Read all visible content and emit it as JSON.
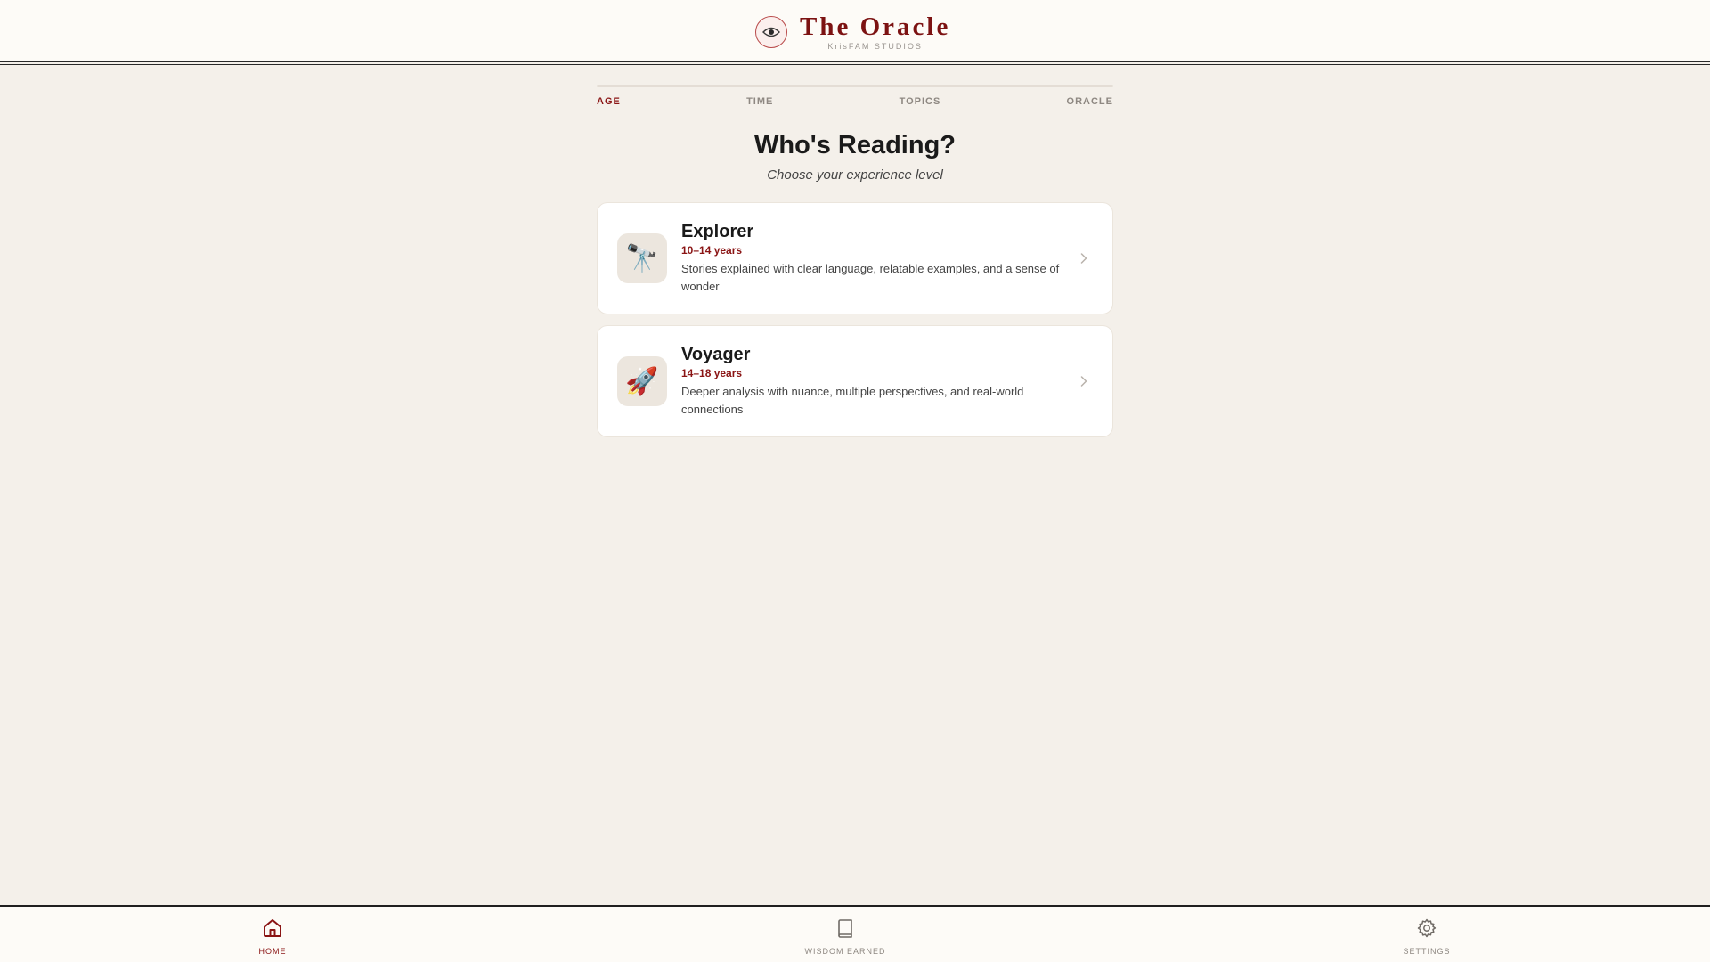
{
  "brand": {
    "title": "The Oracle",
    "subtitle": "KrisFAM STUDIOS",
    "logo_icon": "eye-icon",
    "accent_color": "#7c1212"
  },
  "steps": {
    "items": [
      {
        "label": "AGE",
        "active": true
      },
      {
        "label": "TIME",
        "active": false
      },
      {
        "label": "TOPICS",
        "active": false
      },
      {
        "label": "ORACLE",
        "active": false
      }
    ]
  },
  "heading": {
    "title": "Who's Reading?",
    "subtitle": "Choose your experience level"
  },
  "options": [
    {
      "title": "Explorer",
      "age": "10–14 years",
      "description": "Stories explained with clear language, relatable examples, and a sense of wonder",
      "icon": "🔭",
      "icon_name": "telescope-icon"
    },
    {
      "title": "Voyager",
      "age": "14–18 years",
      "description": "Deeper analysis with nuance, multiple perspectives, and real-world connections",
      "icon": "🚀",
      "icon_name": "rocket-icon"
    }
  ],
  "nav": {
    "items": [
      {
        "label": "HOME",
        "icon": "home-icon",
        "active": true
      },
      {
        "label": "WISDOM EARNED",
        "icon": "book-icon",
        "active": false
      },
      {
        "label": "SETTINGS",
        "icon": "gear-icon",
        "active": false
      }
    ]
  }
}
